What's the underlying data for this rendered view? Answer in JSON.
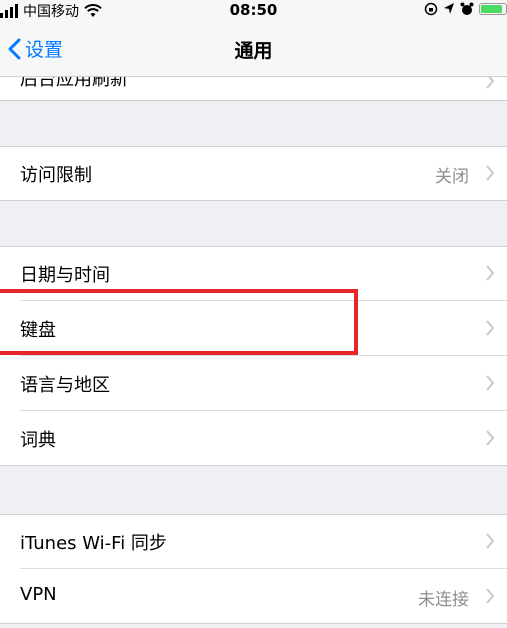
{
  "status_bar": {
    "carrier": "中国移动",
    "time": "08:50"
  },
  "nav": {
    "back_label": "设置",
    "title": "通用"
  },
  "rows": {
    "background_refresh": {
      "label": "后台应用刷新"
    },
    "restrictions": {
      "label": "访问限制",
      "value": "关闭"
    },
    "date_time": {
      "label": "日期与时间"
    },
    "keyboard": {
      "label": "键盘"
    },
    "language_region": {
      "label": "语言与地区"
    },
    "dictionary": {
      "label": "词典"
    },
    "itunes_wifi_sync": {
      "label": "iTunes Wi-Fi 同步"
    },
    "vpn": {
      "label": "VPN",
      "value": "未连接"
    }
  },
  "colors": {
    "accent": "#007aff",
    "highlight": "#e8272d",
    "battery": "#4cd964"
  },
  "icons": [
    "signal-icon",
    "wifi-icon",
    "lock-rotation-icon",
    "location-icon",
    "alarm-icon",
    "battery-icon",
    "back-chevron-icon",
    "chevron-right-icon"
  ]
}
